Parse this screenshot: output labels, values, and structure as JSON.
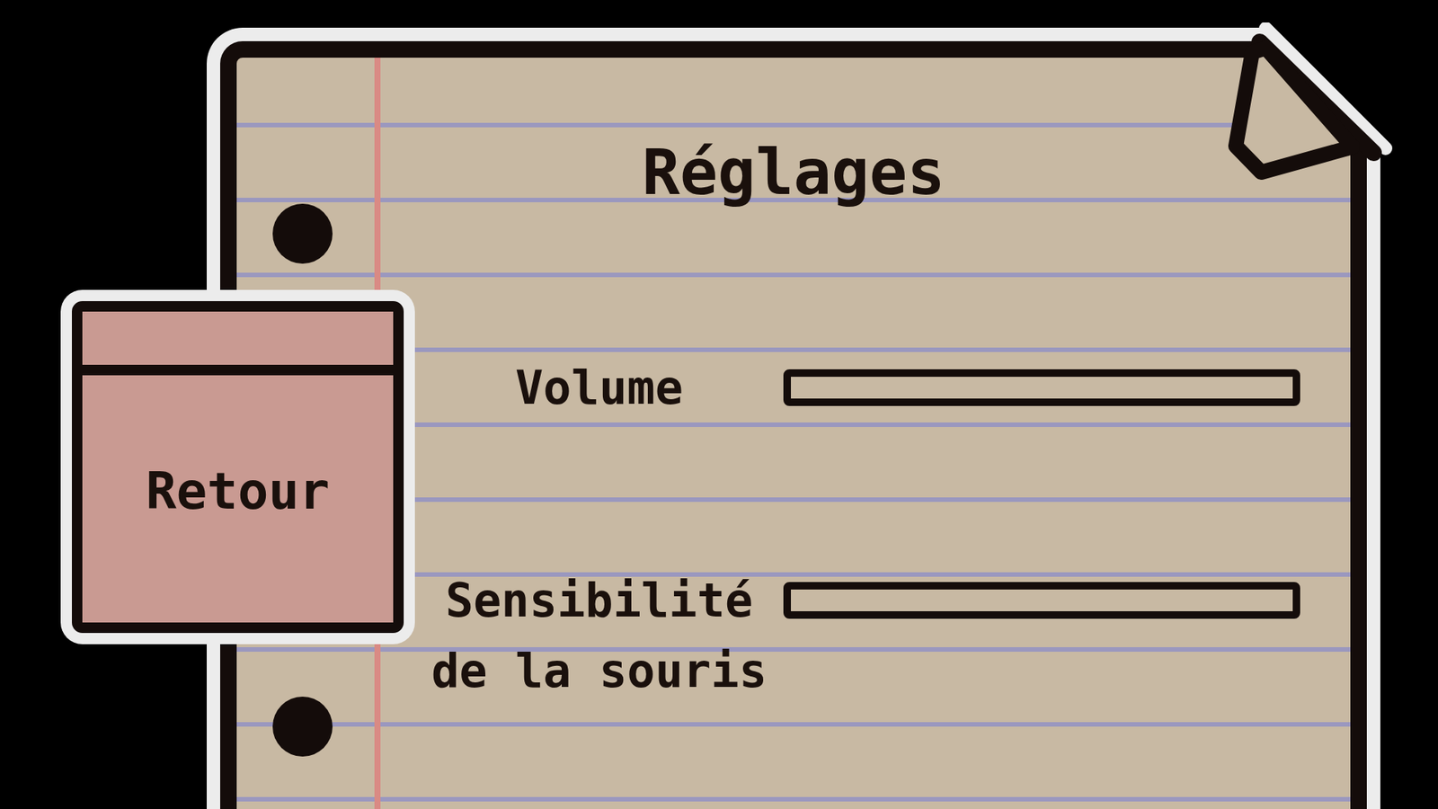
{
  "screen": {
    "title": "Réglages"
  },
  "back_button": {
    "label": "Retour"
  },
  "settings": [
    {
      "label": "Volume",
      "level": 0
    },
    {
      "label": "Sensibilité de la souris",
      "level": 0
    }
  ]
}
